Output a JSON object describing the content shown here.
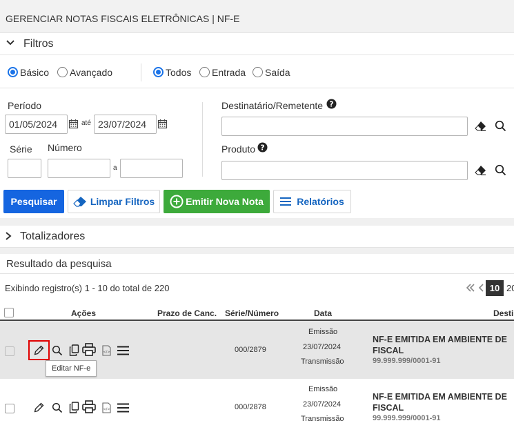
{
  "header": {
    "title": "GERENCIAR NOTAS FISCAIS ELETRÔNICAS | NF-E"
  },
  "filtros": {
    "label": "Filtros",
    "mode_options": [
      {
        "label": "Básico",
        "selected": true
      },
      {
        "label": "Avançado",
        "selected": false
      }
    ],
    "type_options": [
      {
        "label": "Todos",
        "selected": true
      },
      {
        "label": "Entrada",
        "selected": false
      },
      {
        "label": "Saída",
        "selected": false
      }
    ],
    "periodo_label": "Período",
    "periodo_start": "01/05/2024",
    "periodo_ate": "até",
    "periodo_end": "23/07/2024",
    "serie_label": "Série",
    "numero_label": "Número",
    "numero_sep": "a",
    "destinatario_label": "Destinatário/Remetente",
    "produto_label": "Produto"
  },
  "buttons": {
    "pesquisar": "Pesquisar",
    "limpar": "Limpar Filtros",
    "emitir": "Emitir Nova Nota",
    "relatorios": "Relatórios"
  },
  "totalizadores": {
    "label": "Totalizadores"
  },
  "resultado": {
    "label": "Resultado da pesquisa",
    "summary": "Exibindo registro(s) 1 - 10 do total de 220",
    "page_sizes": [
      "10",
      "20"
    ]
  },
  "table": {
    "headers": {
      "acoes": "Ações",
      "prazo": "Prazo de Canc.",
      "serie": "Série/Número",
      "data": "Data",
      "dest": "Destin"
    },
    "rows": [
      {
        "serie": "000/2879",
        "emissao_label": "Emissão",
        "data": "23/07/2024",
        "transmissao_label": "Transmissão",
        "dest_name_1": "NF-E EMITIDA EM AMBIENTE DE",
        "dest_name_2": "FISCAL",
        "cnpj": "99.999.999/0001-91"
      },
      {
        "serie": "000/2878",
        "emissao_label": "Emissão",
        "data": "23/07/2024",
        "transmissao_label": "Transmissão",
        "dest_name_1": "NF-E EMITIDA EM AMBIENTE DE",
        "dest_name_2": "FISCAL",
        "cnpj": "99.999.999/0001-91"
      }
    ]
  },
  "tooltip": {
    "edit": "Editar NF-e"
  },
  "colors": {
    "primary": "#1565e0",
    "success": "#3daa3b",
    "highlight_border": "#e00000",
    "row_selected": "#e6e6e6"
  }
}
